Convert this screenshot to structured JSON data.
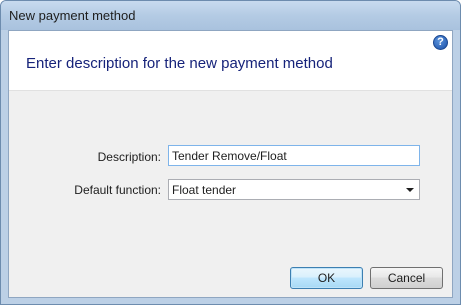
{
  "window": {
    "title": "New payment method"
  },
  "header": {
    "instruction": "Enter description for the new payment method",
    "help_icon": "?"
  },
  "form": {
    "description_label": "Description:",
    "description_value": "Tender Remove/Float",
    "default_function_label": "Default function:",
    "default_function_value": "Float tender"
  },
  "buttons": {
    "ok_label": "OK",
    "cancel_label": "Cancel"
  },
  "colors": {
    "header_text": "#16237a",
    "title_bar": "#b4cbe4",
    "focused_border": "#7eb4ea"
  }
}
